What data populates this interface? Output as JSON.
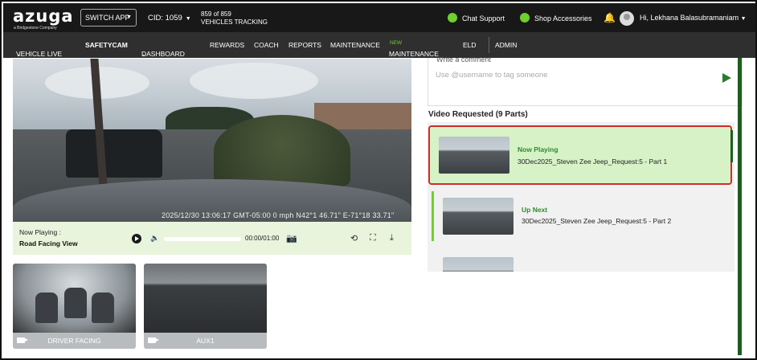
{
  "topbar": {
    "logo": "azuga",
    "logo_sub": "a Bridgestone Company",
    "switch_app": "SWITCH APP",
    "cid": "CID: 1059",
    "vehicles_count": "859 of 859",
    "vehicles_label": "VEHICLES TRACKING",
    "chat_support": "Chat Support",
    "shop_accessories": "Shop Accessories",
    "user_greeting": "Hi, Lekhana Balasubramaniam"
  },
  "nav": {
    "items": [
      "VEHICLE LIVE",
      "SAFETYCAM",
      "DASHBOARD",
      "REWARDS",
      "COACH",
      "REPORTS",
      "MAINTENANCE",
      "MAINTENANCE",
      "ELD",
      "ADMIN"
    ],
    "new_badge": "NEW",
    "active": "SAFETYCAM"
  },
  "video": {
    "overlay": "2025/12/30 13:06:17 GMT-05:00   0 mph   N42°1 46.71\"  E-71°18 33.71\"",
    "now_playing_label": "Now Playing :",
    "view_name": "Road Facing View",
    "time": "00:00/01:00"
  },
  "cameras": [
    {
      "label": "DRIVER FACING"
    },
    {
      "label": "AUX1"
    }
  ],
  "comment": {
    "title": "Write a comment",
    "placeholder": "Use @username to tag someone"
  },
  "requested": {
    "title": "Video Requested (9 Parts)",
    "items": [
      {
        "status": "Now Playing",
        "name": "30Dec2025_Steven Zee Jeep_Request:5 - Part 1"
      },
      {
        "status": "Up Next",
        "name": "30Dec2025_Steven Zee Jeep_Request:5 - Part 2"
      }
    ]
  },
  "colors": {
    "accent": "#6fcf2d",
    "nav_bg": "#2f2f2f",
    "top_bg": "#181818",
    "highlight_border": "#d12b2b"
  }
}
